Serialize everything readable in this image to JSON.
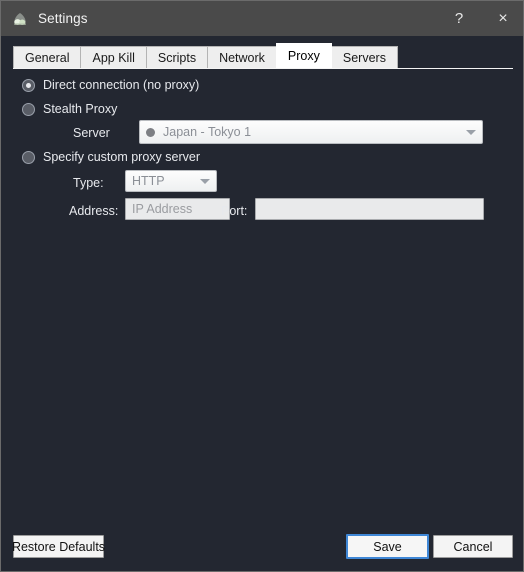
{
  "window": {
    "title": "Settings",
    "icon": "cloud-icon",
    "help_label": "?",
    "close_label": "×",
    "accent_color": "#3f87d6",
    "titlebar_color": "#4a4a4a",
    "body_color": "#232731"
  },
  "tabs": [
    {
      "label": "General",
      "active": false
    },
    {
      "label": "App Kill",
      "active": false
    },
    {
      "label": "Scripts",
      "active": false
    },
    {
      "label": "Network",
      "active": false
    },
    {
      "label": "Proxy",
      "active": true
    },
    {
      "label": "Servers",
      "active": false
    }
  ],
  "proxy": {
    "options": [
      {
        "label": "Direct connection (no proxy)",
        "selected": true
      },
      {
        "label": "Stealth Proxy",
        "selected": false
      },
      {
        "label": "Specify custom proxy server",
        "selected": false
      }
    ],
    "server": {
      "label": "Server",
      "value": "Japan - Tokyo 1",
      "enabled": false
    },
    "type": {
      "label": "Type:",
      "value": "HTTP",
      "enabled": false
    },
    "address": {
      "label": "Address:",
      "value": "",
      "placeholder": "IP Address"
    },
    "port": {
      "label": "Port:",
      "value": "",
      "placeholder": ""
    }
  },
  "footer": {
    "restore_defaults": "Restore Defaults",
    "save": "Save",
    "cancel": "Cancel"
  }
}
